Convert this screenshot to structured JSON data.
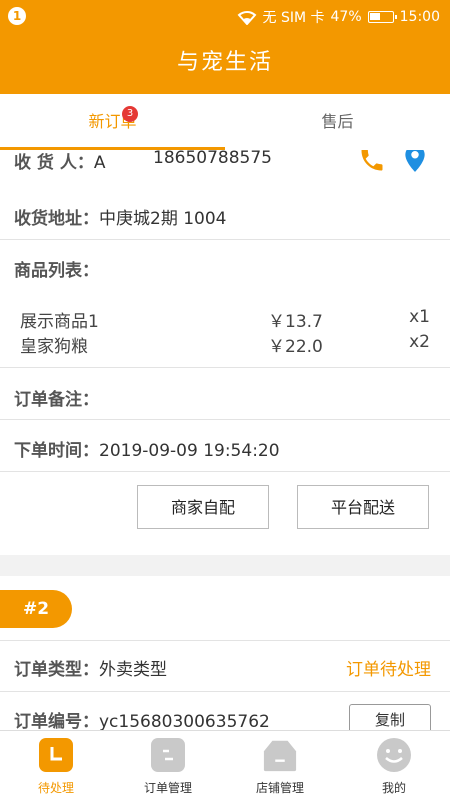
{
  "status_bar": {
    "notification_count": "1",
    "carrier": "无 SIM 卡",
    "battery": "47%",
    "battery_level": 0.47,
    "time": "15:00"
  },
  "app": {
    "title": "与宠生活"
  },
  "tabs": [
    {
      "label": "新订单",
      "badge": "3"
    },
    {
      "label": "售后"
    }
  ],
  "order1": {
    "receiver_label": "收 货 人：",
    "receiver_name": "A",
    "receiver_phone": "18650788575",
    "address_label": "收货地址：",
    "address": "中庚城2期 1004",
    "goods_label": "商品列表：",
    "goods": [
      {
        "name": "展示商品1",
        "price": "￥13.7",
        "qty": "x1"
      },
      {
        "name": "皇家狗粮",
        "price": "￥22.0",
        "qty": "x2"
      }
    ],
    "remark_label": "订单备注：",
    "remark": "",
    "time_label": "下单时间：",
    "time": "2019-09-09 19:54:20",
    "buttons": {
      "self_delivery": "商家自配",
      "platform_delivery": "平台配送"
    }
  },
  "order2": {
    "index_tag": "#2",
    "type_label": "订单类型：",
    "type": "外卖类型",
    "status": "订单待处理",
    "number_label": "订单编号：",
    "number": "yc15680300635762",
    "copy_button": "复制"
  },
  "bottom_nav": [
    {
      "label": "待处理"
    },
    {
      "label": "订单管理"
    },
    {
      "label": "店铺管理"
    },
    {
      "label": "我的"
    }
  ],
  "colors": {
    "accent": "#f39800",
    "map_pin": "#1e8fe1",
    "badge": "#e53935"
  }
}
